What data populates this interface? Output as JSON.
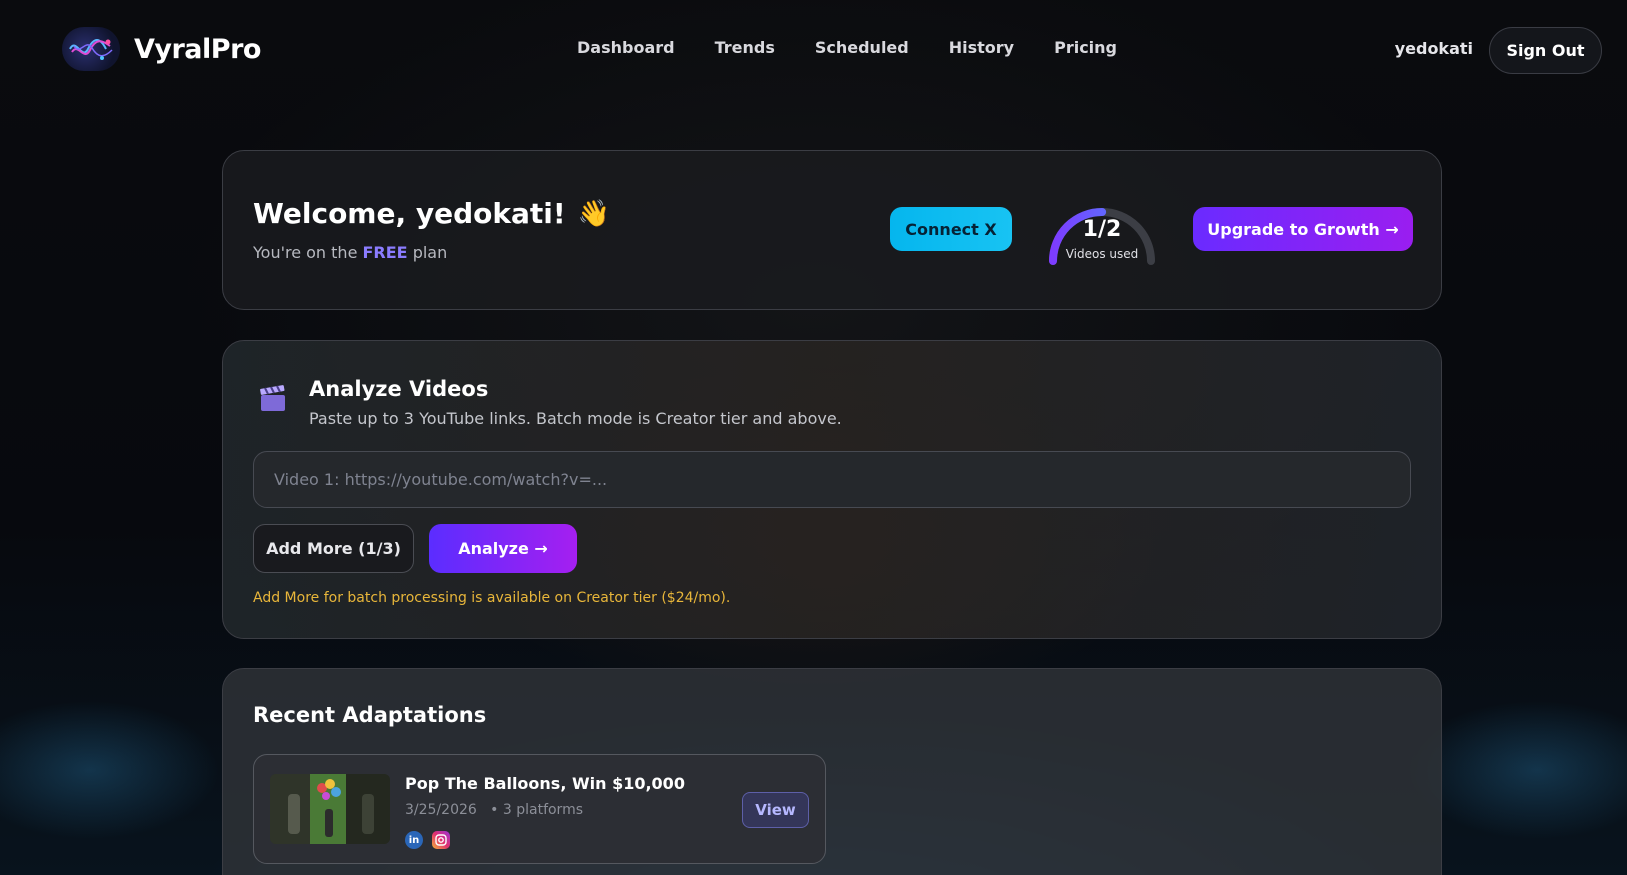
{
  "header": {
    "brand": "VyralPro",
    "nav": [
      {
        "label": "Dashboard"
      },
      {
        "label": "Trends"
      },
      {
        "label": "Scheduled"
      },
      {
        "label": "History"
      },
      {
        "label": "Pricing"
      }
    ],
    "username": "yedokati",
    "sign_out_label": "Sign Out"
  },
  "welcome": {
    "greeting": "Welcome, yedokati!",
    "wave_emoji": "👋",
    "plan_prefix": "You're on the",
    "plan_name": "FREE",
    "plan_suffix": "plan",
    "connect_label": "Connect X",
    "usage_value": "1/2",
    "usage_fraction": 0.5,
    "usage_label": "Videos used",
    "upgrade_label": "Upgrade to Growth →"
  },
  "analyze": {
    "icon": "clapperboard-icon",
    "title": "Analyze Videos",
    "subtitle": "Paste up to 3 YouTube links. Batch mode is Creator tier and above.",
    "input_placeholder": "Video 1: https://youtube.com/watch?v=...",
    "input_value": "",
    "add_more_label": "Add More (1/3)",
    "analyze_label": "Analyze →",
    "notice": "Add More for batch processing is available on Creator tier ($24/mo)."
  },
  "recent": {
    "title": "Recent Adaptations",
    "items": [
      {
        "title": "Pop The Balloons, Win $10,000",
        "date": "3/25/2026",
        "platforms_text": "• 3 platforms",
        "platform_icons": [
          "linkedin-icon",
          "instagram-icon"
        ],
        "view_label": "View"
      }
    ]
  },
  "colors": {
    "accent_purple": "#6a2bff",
    "accent_cyan": "#05b6ee",
    "plan_highlight": "#8b7cff",
    "notice_yellow": "#e8b63a"
  }
}
